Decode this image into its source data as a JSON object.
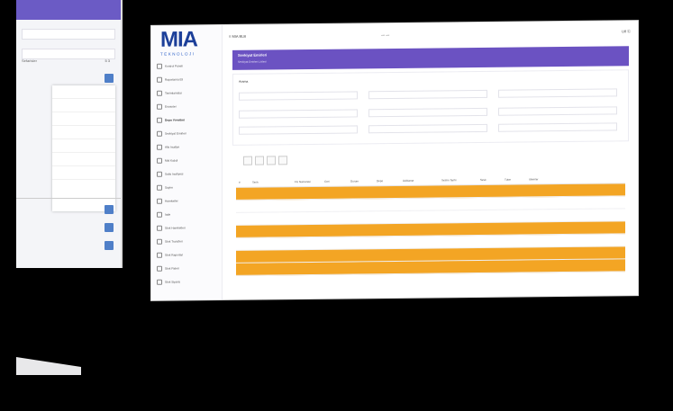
{
  "left_screen": {
    "heading_fragment": "Sefarisler",
    "values": "5 3"
  },
  "brand": {
    "name": "MIA",
    "sub": "TEKNOLOJI"
  },
  "topbar": {
    "left": "≡ MIA BLB",
    "center": "— —",
    "right": "Ulf Ⓒ"
  },
  "sidebar": {
    "items": [
      "Kontrol Paneli",
      "Raporlama Eli",
      "Tanimlamalar",
      "Envanter",
      "Depo Yonetimi",
      "Sevkiyat Emirleri",
      "Alis Irsaliye",
      "Mal Kabul",
      "Satis Irsaliyesi",
      "Sayim",
      "Hareketler",
      "Iade",
      "Stok Hareketleri",
      "Stok Transferi",
      "Stok Raporlari",
      "Stok Fisleri",
      "Stok Siparis"
    ]
  },
  "page": {
    "title": "Sevkiyat Emirleri",
    "subtitle": "Sevkiyat Emirleri Listesi"
  },
  "filters": {
    "title": "Arama"
  },
  "table": {
    "headers": [
      "#",
      "Tarih",
      "Fis Numarasi",
      "Cari",
      "Durum",
      "Depo",
      "Aciklama",
      "Teslim Tarihi",
      "Sevk",
      "Tutar",
      "Islemler"
    ],
    "rows": [
      {
        "hl": true
      },
      {
        "hl": false
      },
      {
        "hl": false
      },
      {
        "hl": true
      },
      {
        "hl": false
      },
      {
        "hl": true
      },
      {
        "hl": true
      }
    ]
  }
}
